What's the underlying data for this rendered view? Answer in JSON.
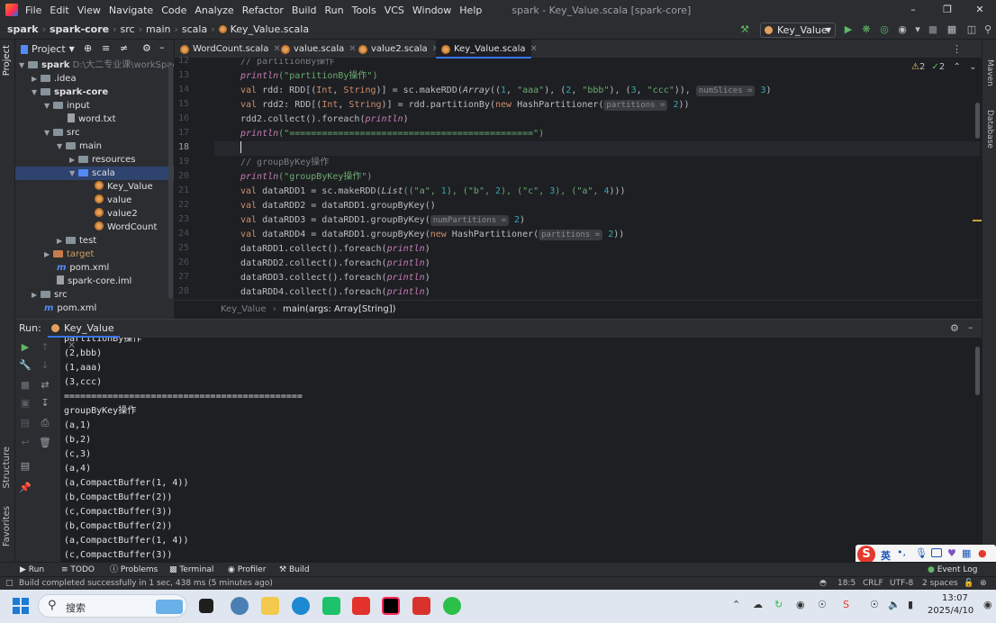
{
  "menubar": {
    "items": [
      "File",
      "Edit",
      "View",
      "Navigate",
      "Code",
      "Analyze",
      "Refactor",
      "Build",
      "Run",
      "Tools",
      "VCS",
      "Window",
      "Help"
    ],
    "window_title": "spark - Key_Value.scala [spark-core]"
  },
  "navbar": {
    "crumbs": [
      "spark",
      "spark-core",
      "src",
      "main",
      "scala",
      "Key_Value.scala"
    ],
    "run_config": "Key_Value"
  },
  "side_labels": {
    "project": "Project",
    "structure": "Structure",
    "favorites": "Favorites",
    "maven": "Maven",
    "database": "Database"
  },
  "project_panel": {
    "title": "Project",
    "tree": [
      {
        "label": "spark",
        "extra": "D:\\大二专业课\\workSpace",
        "bold": true
      },
      {
        "label": ".idea"
      },
      {
        "label": "spark-core",
        "bold": true
      },
      {
        "label": "input"
      },
      {
        "label": "word.txt"
      },
      {
        "label": "src"
      },
      {
        "label": "main"
      },
      {
        "label": "resources"
      },
      {
        "label": "scala"
      },
      {
        "label": "Key_Value"
      },
      {
        "label": "value"
      },
      {
        "label": "value2"
      },
      {
        "label": "WordCount"
      },
      {
        "label": "test"
      },
      {
        "label": "target"
      },
      {
        "label": "pom.xml"
      },
      {
        "label": "spark-core.iml"
      },
      {
        "label": "src"
      },
      {
        "label": "pom.xml"
      }
    ]
  },
  "editor": {
    "tabs": [
      "WordCount.scala",
      "value.scala",
      "value2.scala",
      "Key_Value.scala"
    ],
    "active_tab": "Key_Value.scala",
    "inspections": {
      "warnings": "2",
      "ok": "2"
    },
    "line_numbers": [
      "12",
      "13",
      "14",
      "15",
      "16",
      "17",
      "18",
      "19",
      "20",
      "21",
      "22",
      "23",
      "24",
      "25",
      "26",
      "27",
      "28"
    ],
    "current_line": "18",
    "lines": {
      "l12": "// partitionBy操作",
      "l13a": "println",
      "l13b": "(\"partitionBy操作\")",
      "l14a": "val",
      "l14b": " rdd: RDD[(",
      "l14c": "Int",
      "l14d": ", ",
      "l14e": "String",
      "l14f": ")] = sc.makeRDD(",
      "l14g": "Array",
      "l14h": "((",
      "l14i": "1",
      "l14j": ", ",
      "l14k": "\"aaa\"",
      "l14l": "), (",
      "l14m": "2",
      "l14n": ", ",
      "l14o": "\"bbb\"",
      "l14p": "), (",
      "l14q": "3",
      "l14r": ", ",
      "l14s": "\"ccc\"",
      "l14t": ")), ",
      "l14hint": "numSlices =",
      "l14u": " 3",
      "l14v": ")",
      "l15a": "val",
      "l15b": " rdd2: RDD[(",
      "l15c": "Int",
      "l15d": ", ",
      "l15e": "String",
      "l15f": ")] = rdd.partitionBy(",
      "l15g": "new",
      "l15h": " HashPartitioner(",
      "l15hint": "partitions =",
      "l15i": " 2",
      "l15j": "))",
      "l16": "rdd2.collect().foreach(",
      "l16b": "println",
      "l16c": ")",
      "l17a": "println",
      "l17b": "(\"=============================================\")",
      "l19": "// groupByKey操作",
      "l20a": "println",
      "l20b": "(\"groupByKey操作\")",
      "l21a": "val",
      "l21b": " dataRDD1 = sc.makeRDD(",
      "l21c": "List",
      "l21d": "((\"a\", ",
      "l21e": "1",
      "l21f": "), (\"b\", ",
      "l21g": "2",
      "l21h": "), (\"c\", ",
      "l21i": "3",
      "l21j": "), (\"a\", ",
      "l21k": "4",
      "l21l": ")))",
      "l22a": "val",
      "l22b": " dataRDD2 = dataRDD1.groupByKey()",
      "l23a": "val",
      "l23b": " dataRDD3 = dataRDD1.groupByKey(",
      "l23hint": "numPartitions =",
      "l23c": " 2",
      "l23d": ")",
      "l24a": "val",
      "l24b": " dataRDD4 = dataRDD1.groupByKey(",
      "l24c": "new",
      "l24d": " HashPartitioner(",
      "l24hint": "partitions =",
      "l24e": " 2",
      "l24f": "))",
      "l25": "dataRDD1.collect().foreach(",
      "l25b": "println",
      "l25c": ")",
      "l26": "dataRDD2.collect().foreach(",
      "l26b": "println",
      "l26c": ")",
      "l27": "dataRDD3.collect().foreach(",
      "l27b": "println",
      "l27c": ")",
      "l28": "dataRDD4.collect().foreach(",
      "l28b": "println",
      "l28c": ")"
    },
    "crumbs": {
      "object": "Key_Value",
      "method": "main(args: Array[String])"
    }
  },
  "run_panel": {
    "label": "Run:",
    "tab": "Key_Value",
    "output": [
      "partitionBy操作",
      "(2,bbb)",
      "(1,aaa)",
      "(3,ccc)",
      "============================================",
      "groupByKey操作",
      "(a,1)",
      "(b,2)",
      "(c,3)",
      "(a,4)",
      "(a,CompactBuffer(1, 4))",
      "(b,CompactBuffer(2))",
      "(c,CompactBuffer(3))",
      "(b,CompactBuffer(2))",
      "(a,CompactBuffer(1, 4))",
      "(c,CompactBuffer(3))"
    ]
  },
  "bottom_tabs": [
    "Run",
    "TODO",
    "Problems",
    "Terminal",
    "Profiler",
    "Build"
  ],
  "event_log": "Event Log",
  "status": {
    "message": "Build completed successfully in 1 sec, 438 ms (5 minutes ago)",
    "position": "18:5",
    "line_sep": "CRLF",
    "encoding": "UTF-8",
    "indent": "2 spaces"
  },
  "ime": {
    "lang": "英"
  },
  "taskbar": {
    "search_placeholder": "搜索",
    "time": "13:07",
    "date": "2025/4/10"
  },
  "colors": {
    "accent": "#3574f0",
    "editor_bg": "#1e1f22",
    "panel_bg": "#2b2d30",
    "keyword": "#cf8e6d",
    "string": "#6aab73",
    "number": "#2aacb8"
  }
}
